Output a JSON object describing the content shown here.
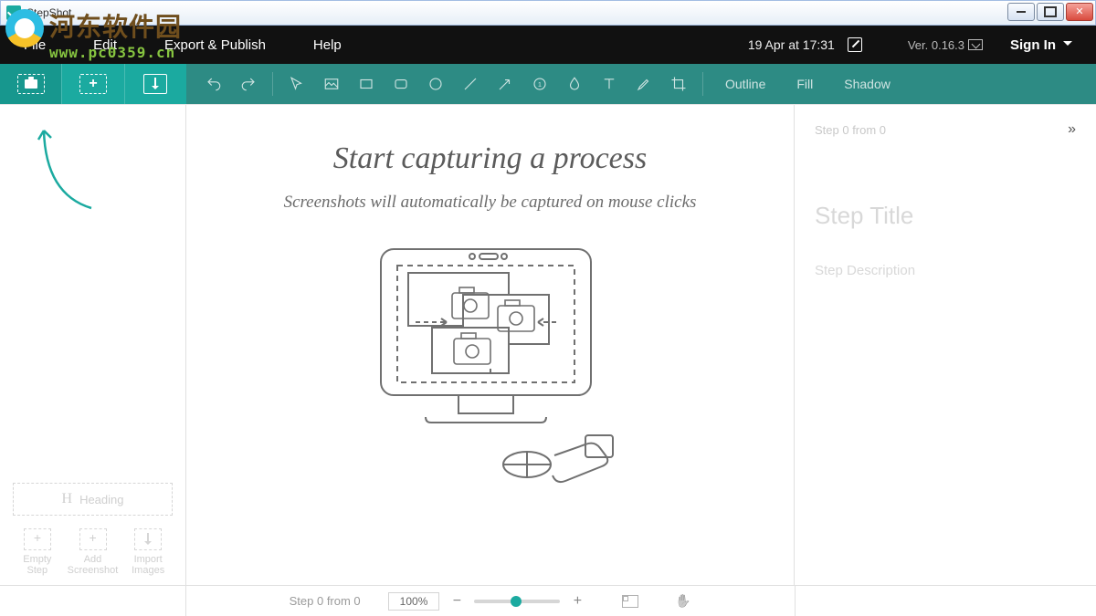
{
  "window": {
    "title": "StepShot"
  },
  "watermark": {
    "text": "河东软件园",
    "url": "www.pc0359.cn"
  },
  "menu": {
    "items": [
      "File",
      "Edit",
      "Export & Publish",
      "Help"
    ],
    "date": "19 Apr at 17:31",
    "version": "Ver. 0.16.3",
    "signin": "Sign In"
  },
  "toolbar": {
    "styles": {
      "outline": "Outline",
      "fill": "Fill",
      "shadow": "Shadow"
    }
  },
  "leftPanel": {
    "heading": "Heading",
    "buttons": {
      "empty": "Empty\nStep",
      "add": "Add\nScreenshot",
      "import": "Import\nImages"
    }
  },
  "canvas": {
    "title": "Start capturing a process",
    "subtitle": "Screenshots will automatically be captured on mouse clicks"
  },
  "rightPanel": {
    "stepCounter": "Step 0 from 0",
    "titlePlaceholder": "Step Title",
    "descPlaceholder": "Step Description"
  },
  "status": {
    "step": "Step 0 from 0",
    "zoom": "100%"
  }
}
